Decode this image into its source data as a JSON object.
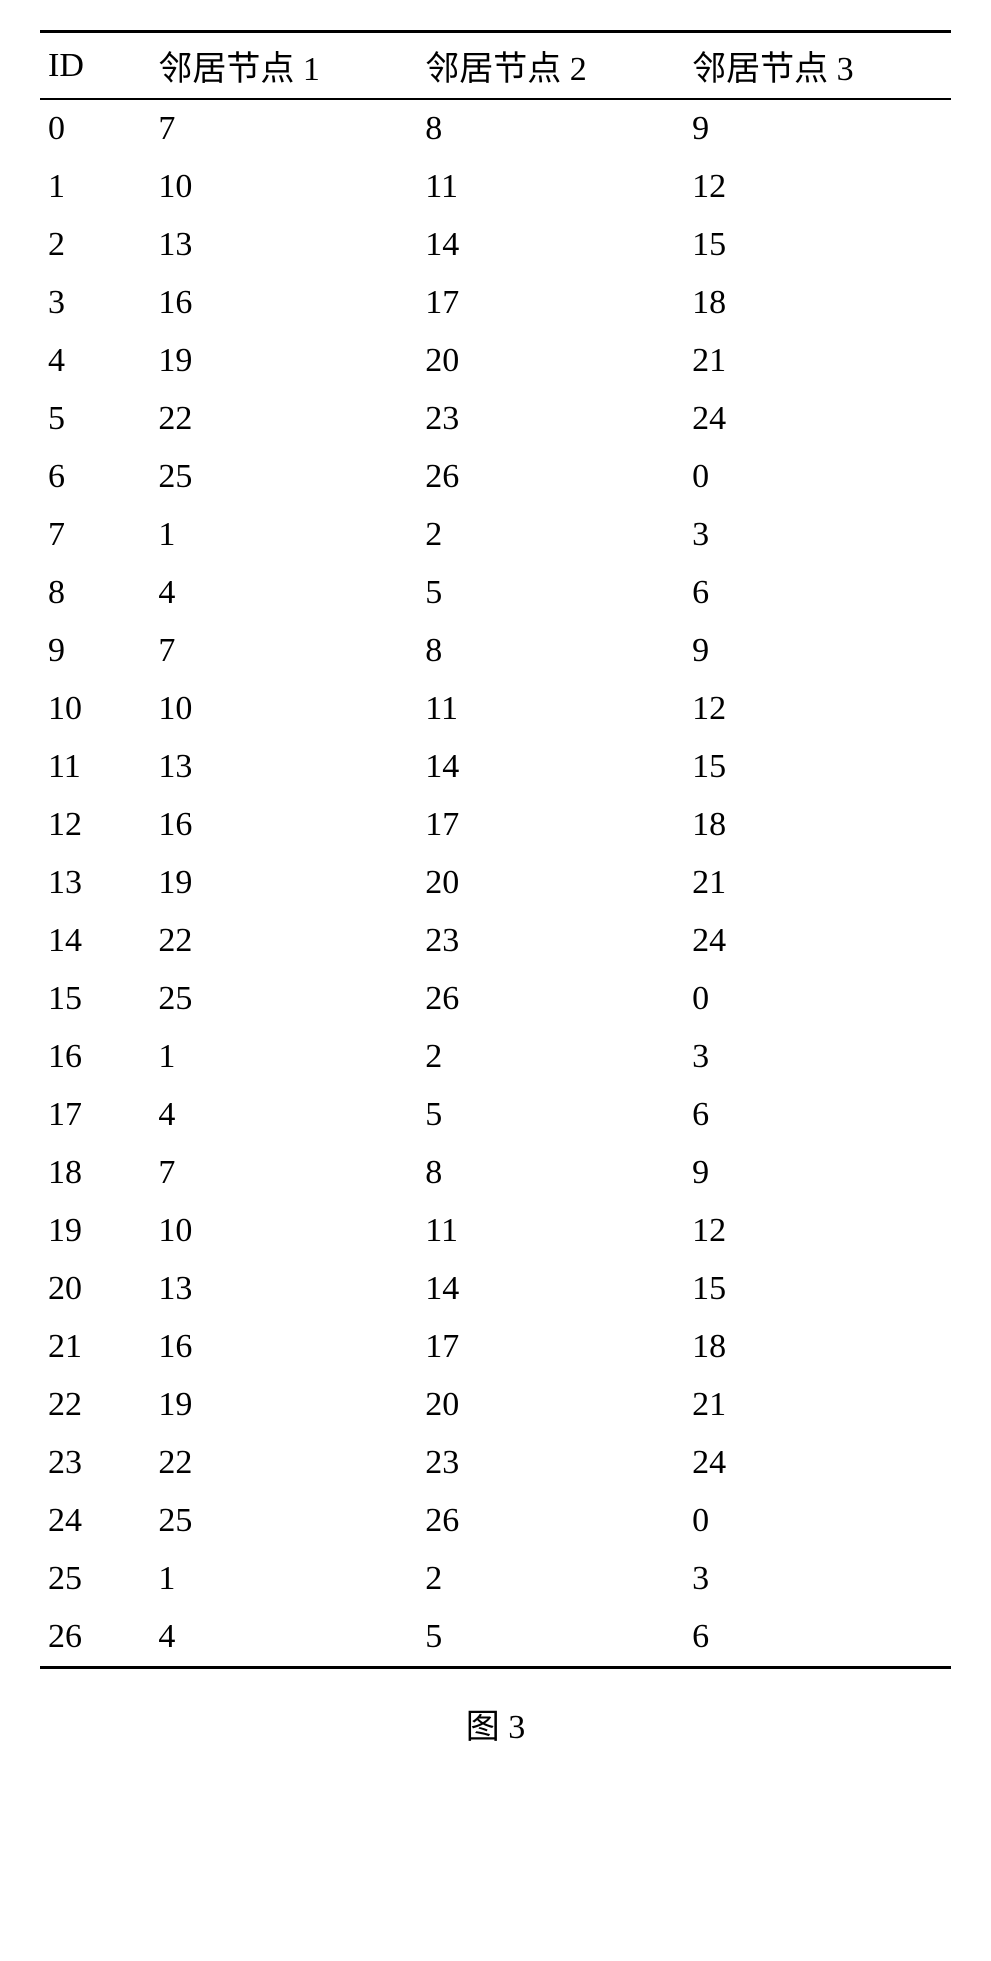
{
  "table": {
    "headers": [
      "ID",
      "邻居节点 1",
      "邻居节点 2",
      "邻居节点 3"
    ],
    "rows": [
      [
        "0",
        "7",
        "8",
        "9"
      ],
      [
        "1",
        "10",
        "11",
        "12"
      ],
      [
        "2",
        "13",
        "14",
        "15"
      ],
      [
        "3",
        "16",
        "17",
        "18"
      ],
      [
        "4",
        "19",
        "20",
        "21"
      ],
      [
        "5",
        "22",
        "23",
        "24"
      ],
      [
        "6",
        "25",
        "26",
        "0"
      ],
      [
        "7",
        "1",
        "2",
        "3"
      ],
      [
        "8",
        "4",
        "5",
        "6"
      ],
      [
        "9",
        "7",
        "8",
        "9"
      ],
      [
        "10",
        "10",
        "11",
        "12"
      ],
      [
        "11",
        "13",
        "14",
        "15"
      ],
      [
        "12",
        "16",
        "17",
        "18"
      ],
      [
        "13",
        "19",
        "20",
        "21"
      ],
      [
        "14",
        "22",
        "23",
        "24"
      ],
      [
        "15",
        "25",
        "26",
        "0"
      ],
      [
        "16",
        "1",
        "2",
        "3"
      ],
      [
        "17",
        "4",
        "5",
        "6"
      ],
      [
        "18",
        "7",
        "8",
        "9"
      ],
      [
        "19",
        "10",
        "11",
        "12"
      ],
      [
        "20",
        "13",
        "14",
        "15"
      ],
      [
        "21",
        "16",
        "17",
        "18"
      ],
      [
        "22",
        "19",
        "20",
        "21"
      ],
      [
        "23",
        "22",
        "23",
        "24"
      ],
      [
        "24",
        "25",
        "26",
        "0"
      ],
      [
        "25",
        "1",
        "2",
        "3"
      ],
      [
        "26",
        "4",
        "5",
        "6"
      ]
    ]
  },
  "caption": "图 3"
}
